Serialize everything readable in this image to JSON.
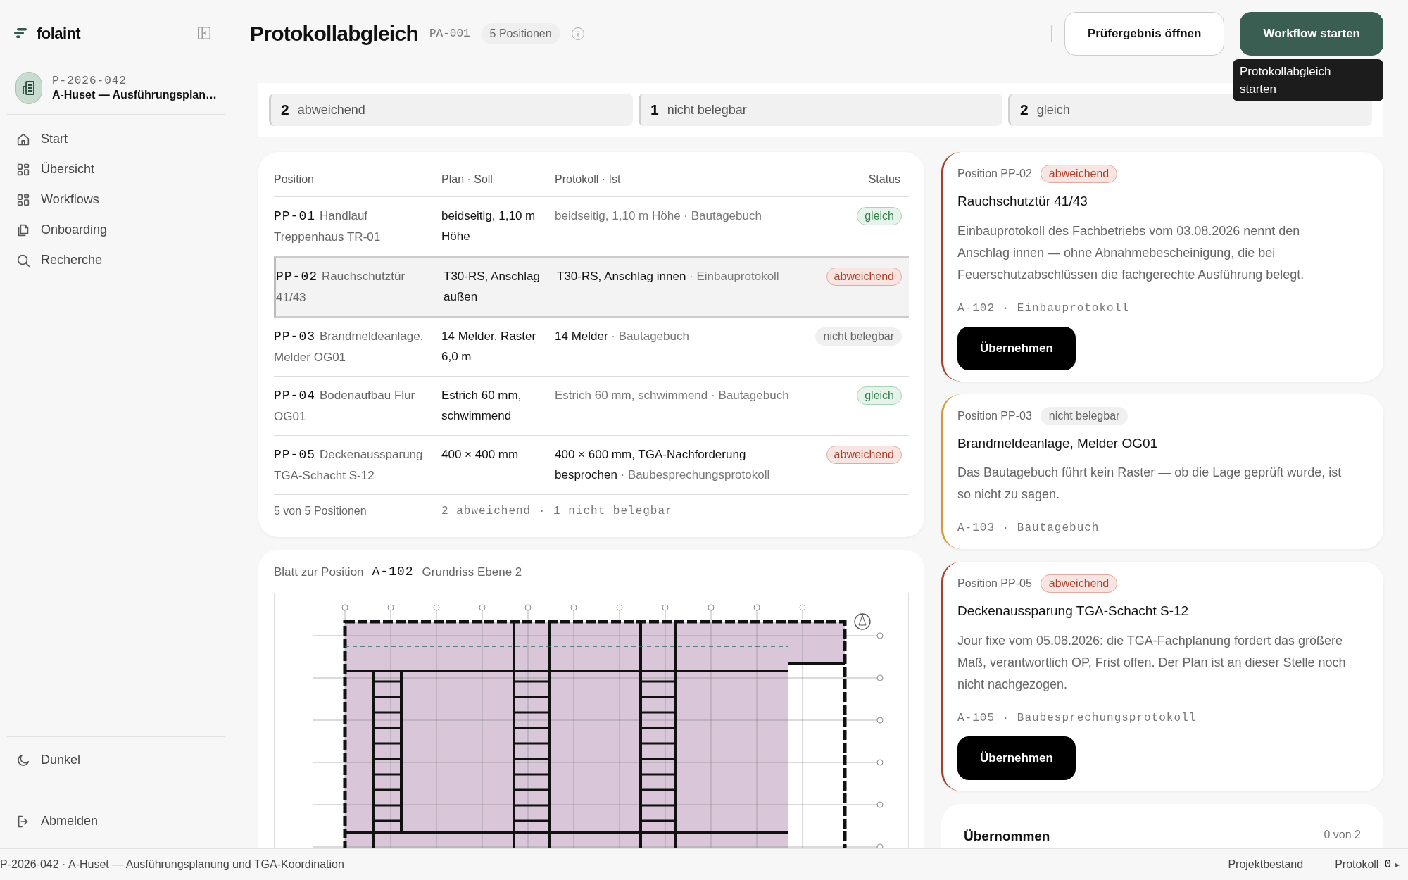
{
  "sidebar": {
    "brand": "folaint",
    "project": {
      "code": "P-2026-042",
      "name": "A-Huset — Ausführungsplan…"
    },
    "nav": [
      {
        "label": "Start",
        "selected": false
      },
      {
        "label": "Übersicht",
        "selected": false
      },
      {
        "label": "Workflows",
        "selected": false
      },
      {
        "label": "Onboarding",
        "selected": false
      },
      {
        "label": "Recherche",
        "selected": false
      }
    ],
    "footer": [
      {
        "label": "Dunkel"
      },
      {
        "label": "Abmelden"
      }
    ]
  },
  "header": {
    "title": "Protokollabgleich",
    "code": "PA-001",
    "count": "5 Positionen",
    "buttons": [
      {
        "label": "Prüfergebnis öffnen",
        "kind": "secondary"
      },
      {
        "label": "Workflow starten",
        "kind": "primary"
      }
    ],
    "tooltip": "Protokollabgleich starten"
  },
  "summary": [
    {
      "count": "2",
      "label": "abweichend"
    },
    {
      "count": "1",
      "label": "nicht belegbar"
    },
    {
      "count": "2",
      "label": "gleich"
    }
  ],
  "table": {
    "columns": [
      "Position",
      "Plan · Soll",
      "Protokoll · Ist",
      "Status"
    ],
    "rows": [
      {
        "code": "PP-01",
        "name": "Handlauf Treppenhaus TR-01",
        "plan": "beidseitig, 1,10 m Höhe",
        "actual": "beidseitig, 1,10 m Höhe",
        "source": "· Bautagebuch",
        "status": "gleich",
        "kind": "equal",
        "selected": false
      },
      {
        "code": "PP-02",
        "name": "Rauchschutztür 41/43",
        "plan": "T30-RS, Anschlag außen",
        "actual": "T30-RS, Anschlag innen",
        "source": "· Einbauprotokoll",
        "status": "abweichend",
        "kind": "deviating",
        "selected": true
      },
      {
        "code": "PP-03",
        "name": "Brandmeldeanlage, Melder OG01",
        "plan": "14 Melder, Raster 6,0 m",
        "actual": "14 Melder",
        "source": "· Bautagebuch",
        "status": "nicht belegbar",
        "kind": "unproven",
        "selected": false
      },
      {
        "code": "PP-04",
        "name": "Bodenaufbau Flur OG01",
        "plan": "Estrich 60 mm, schwimmend",
        "actual": "Estrich 60 mm, schwimmend",
        "source": "· Bautagebuch",
        "status": "gleich",
        "kind": "equal",
        "selected": false
      },
      {
        "code": "PP-05",
        "name": "Deckenaussparung TGA-Schacht S-12",
        "plan": "400 × 400 mm",
        "actual": "400 × 600 mm, TGA-Nachforderung besprochen",
        "source": "· Baubesprechungsprotokoll",
        "status": "abweichend",
        "kind": "deviating",
        "selected": false
      }
    ],
    "footer_count": "5 von 5 Positionen",
    "footer_summary": "2 abweichend · 1 nicht belegbar"
  },
  "sheet": {
    "label": "Blatt zur Position",
    "code": "A-102",
    "title": "Grundriss Ebene 2"
  },
  "findings": [
    {
      "position": "Position PP-02",
      "status": "abweichend",
      "kind": "deviating",
      "title": "Rauchschutztür 41/43",
      "text": "Einbauprotokoll des Fachbetriebs vom 03.08.2026 nennt den Anschlag innen — ohne Abnahmebescheinigung, die bei Feuerschutzabschlüssen die fachgerechte Ausführung belegt.",
      "reference": "A-102 · Einbauprotokoll",
      "button": "Übernehmen"
    },
    {
      "position": "Position PP-03",
      "status": "nicht belegbar",
      "kind": "unproven",
      "title": "Brandmeldeanlage, Melder OG01",
      "text": "Das Bautagebuch führt kein Raster — ob die Lage geprüft wurde, ist so nicht zu sagen.",
      "reference": "A-103 · Bautagebuch"
    },
    {
      "position": "Position PP-05",
      "status": "abweichend",
      "kind": "deviating",
      "title": "Deckenaussparung TGA-Schacht S-12",
      "text": "Jour fixe vom 05.08.2026: die TGA-Fachplanung fordert das größere Maß, verantwortlich OP, Frist offen. Der Plan ist an dieser Stelle noch nicht nachgezogen.",
      "reference": "A-105 · Baubesprechungsprotokoll",
      "button": "Übernehmen"
    }
  ],
  "accepted": {
    "title": "Übernommen",
    "count": "0 von 2"
  },
  "status_bar": {
    "project": "P-2026-042 · A-Huset — Ausführungsplanung und TGA-Koordination",
    "links": [
      "Projektbestand",
      "Protokoll"
    ],
    "counter": "0",
    "arrow": "▸"
  }
}
